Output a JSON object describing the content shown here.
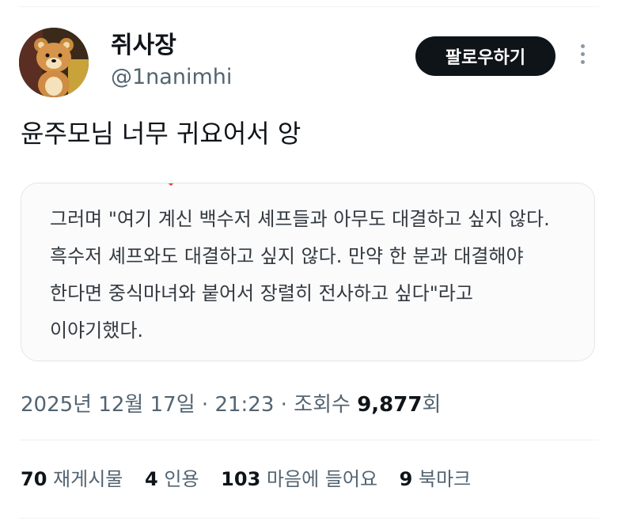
{
  "user": {
    "display_name": "쥐사장",
    "handle": "@1nanimhi",
    "avatar_icon": "bear-plush-avatar"
  },
  "actions": {
    "follow_label": "팔로우하기",
    "more_icon": "vertical-ellipsis-icon"
  },
  "tweet": {
    "text": "윤주모님 너무 귀요어서 앙",
    "quote_image_text": "그러며 \"여기 계신 백수저 셰프들과 아무도 대결하고 싶지 않다. 흑수저 셰프와도 대결하고 싶지 않다. 만약 한 분과 대결해야 한다면 중식마녀와 붙어서 장렬히 전사하고 싶다\"라고 이야기했다."
  },
  "meta": {
    "date": "2025년 12월 17일",
    "separator": "·",
    "time": "21:23",
    "views_label": "조회수",
    "views_count": "9,877",
    "views_suffix": "회"
  },
  "stats": [
    {
      "count": "70",
      "label": "재게시물"
    },
    {
      "count": "4",
      "label": "인용"
    },
    {
      "count": "103",
      "label": "마음에 들어요"
    },
    {
      "count": "9",
      "label": "북마크"
    }
  ],
  "colors": {
    "text": "#0f1419",
    "secondary": "#536471",
    "button_bg": "#0f1419",
    "border": "#eff3f4"
  }
}
